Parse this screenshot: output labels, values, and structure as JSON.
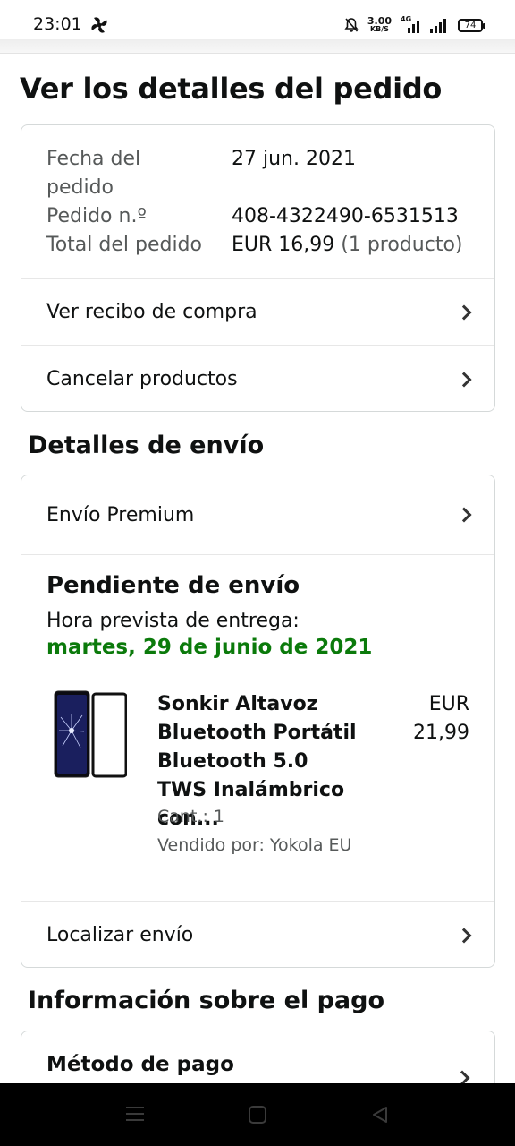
{
  "status_bar": {
    "time": "23:01",
    "net_speed_value": "3.00",
    "net_speed_unit": "KB/S",
    "network_type": "4G",
    "battery": "74",
    "icons": [
      "fan-app-icon",
      "mute-bell-icon",
      "signal-4g-icon",
      "signal-icon",
      "battery-icon"
    ]
  },
  "page": {
    "title": "Ver los detalles del pedido"
  },
  "order_summary": {
    "date_label": "Fecha del pedido",
    "date_value": "27 jun. 2021",
    "number_label": "Pedido n.º",
    "number_value": "408-4322490-6531513",
    "total_label": "Total del pedido",
    "total_value": "EUR 16,99",
    "total_items": "(1 producto)"
  },
  "order_links": [
    {
      "label": "Ver recibo de compra"
    },
    {
      "label": "Cancelar productos"
    }
  ],
  "shipping": {
    "section_title": "Detalles de envío",
    "method_label": "Envío Premium",
    "status": "Pendiente de envío",
    "eta_label": "Hora prevista de entrega:",
    "eta_date": "martes, 29 de junio de 2021",
    "product": {
      "title": "Sonkir Altavoz Bluetooth Portátil Bluetooth 5.0 TWS Inalámbrico con...",
      "price_currency": "EUR",
      "price_amount": "21,99",
      "quantity": "Cant.: 1",
      "seller": "Vendido por: Yokola EU"
    },
    "track_label": "Localizar envío"
  },
  "payment": {
    "section_title": "Información sobre el pago",
    "method_label": "Método de pago"
  },
  "colors": {
    "eta_green": "#0b7a0b",
    "border": "#d5d9d9",
    "muted_text": "#565959"
  }
}
